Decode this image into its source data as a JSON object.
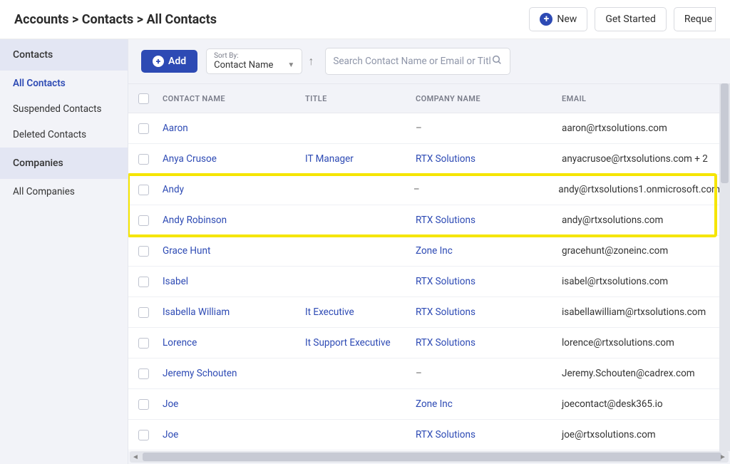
{
  "breadcrumb": "Accounts > Contacts > All Contacts",
  "header": {
    "new": "New",
    "get_started": "Get Started",
    "request": "Reque"
  },
  "sidebar": {
    "contacts_title": "Contacts",
    "contacts_items": [
      "All Contacts",
      "Suspended Contacts",
      "Deleted Contacts"
    ],
    "companies_title": "Companies",
    "companies_items": [
      "All Companies"
    ]
  },
  "toolbar": {
    "add": "Add",
    "sort_label": "Sort By:",
    "sort_value": "Contact Name",
    "search_placeholder": "Search Contact Name or Email or Title"
  },
  "columns": {
    "name": "CONTACT NAME",
    "title": "TITLE",
    "company": "COMPANY NAME",
    "email": "EMAIL"
  },
  "rows": [
    {
      "name": "Aaron",
      "title": "",
      "company": "–",
      "company_link": false,
      "email": "aaron@rtxsolutions.com"
    },
    {
      "name": "Anya Crusoe",
      "title": "IT Manager",
      "company": "RTX Solutions",
      "company_link": true,
      "email": "anyacrusoe@rtxsolutions.com + 2"
    },
    {
      "name": "Andy",
      "title": "",
      "company": "–",
      "company_link": false,
      "email": "andy@rtxsolutions1.onmicrosoft.com"
    },
    {
      "name": "Andy Robinson",
      "title": "",
      "company": "RTX Solutions",
      "company_link": true,
      "email": "andy@rtxsolutions.com"
    },
    {
      "name": "Grace Hunt",
      "title": "",
      "company": "Zone Inc",
      "company_link": true,
      "email": "gracehunt@zoneinc.com"
    },
    {
      "name": "Isabel",
      "title": "",
      "company": "RTX Solutions",
      "company_link": true,
      "email": "isabel@rtxsolutions.com"
    },
    {
      "name": "Isabella William",
      "title": "It Executive",
      "company": "RTX Solutions",
      "company_link": true,
      "email": "isabellawilliam@rtxsolutions.com"
    },
    {
      "name": "Lorence",
      "title": "It Support Executive",
      "company": "RTX Solutions",
      "company_link": true,
      "email": "lorence@rtxsolutions.com"
    },
    {
      "name": "Jeremy Schouten",
      "title": "",
      "company": "–",
      "company_link": false,
      "email": "Jeremy.Schouten@cadrex.com"
    },
    {
      "name": "Joe",
      "title": "",
      "company": "Zone Inc",
      "company_link": true,
      "email": "joecontact@desk365.io"
    },
    {
      "name": "Joe",
      "title": "",
      "company": "RTX Solutions",
      "company_link": true,
      "email": "joe@rtxsolutions.com"
    }
  ],
  "highlight": {
    "start": 2,
    "end": 3
  }
}
